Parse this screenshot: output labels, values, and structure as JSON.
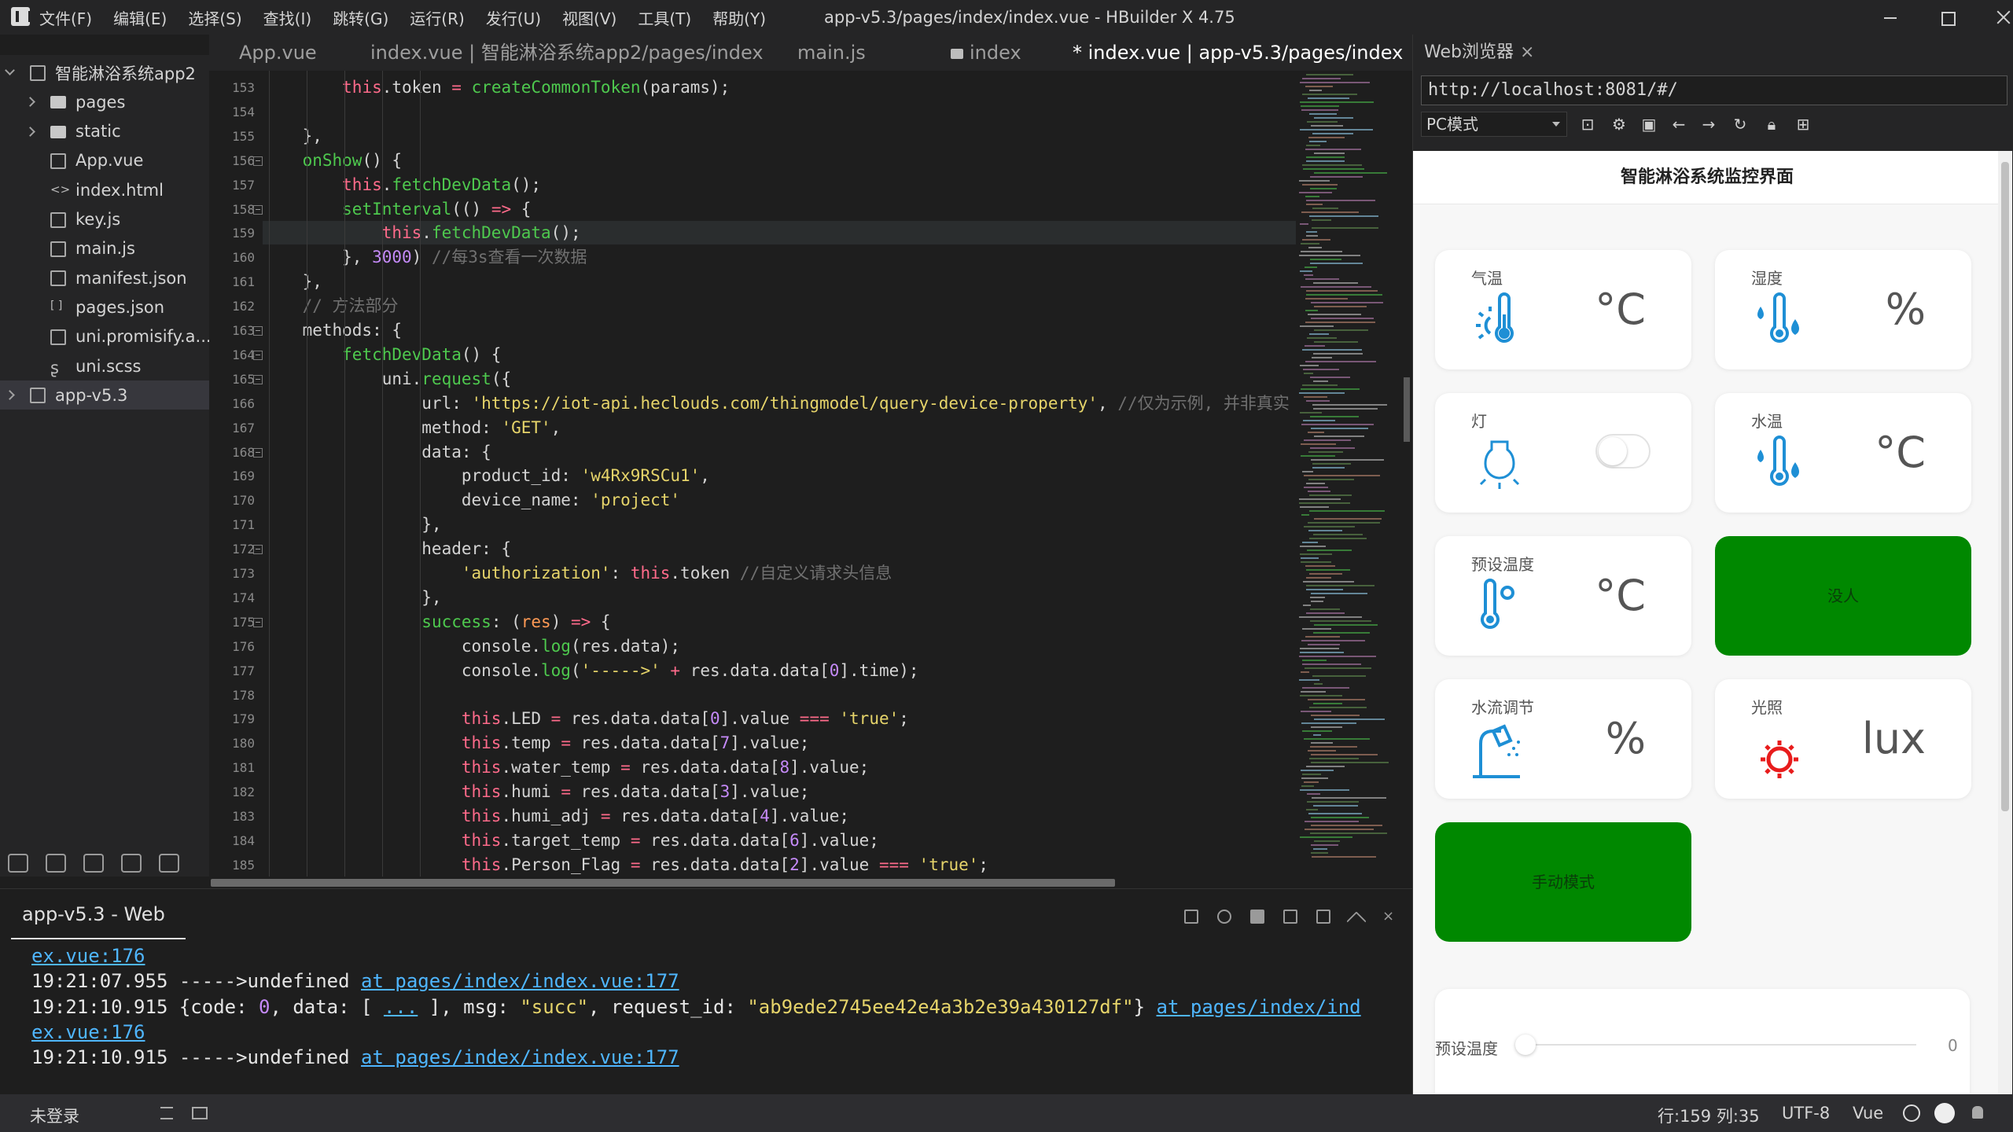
{
  "window": {
    "title": "app-v5.3/pages/index/index.vue - HBuilder X 4.75"
  },
  "menu": [
    "文件(F)",
    "编辑(E)",
    "选择(S)",
    "查找(I)",
    "跳转(G)",
    "运行(R)",
    "发行(U)",
    "视图(V)",
    "工具(T)",
    "帮助(Y)"
  ],
  "sidebar": {
    "items": [
      {
        "label": "智能淋浴系统app2",
        "kind": "project",
        "indent": 0,
        "chev": "down"
      },
      {
        "label": "pages",
        "kind": "folder",
        "indent": 1,
        "chev": "right"
      },
      {
        "label": "static",
        "kind": "folder",
        "indent": 1,
        "chev": "right"
      },
      {
        "label": "App.vue",
        "kind": "file",
        "indent": 1
      },
      {
        "label": "index.html",
        "kind": "html",
        "indent": 1
      },
      {
        "label": "key.js",
        "kind": "file",
        "indent": 1
      },
      {
        "label": "main.js",
        "kind": "file",
        "indent": 1
      },
      {
        "label": "manifest.json",
        "kind": "file",
        "indent": 1
      },
      {
        "label": "pages.json",
        "kind": "json",
        "indent": 1
      },
      {
        "label": "uni.promisify.a...",
        "kind": "file",
        "indent": 1
      },
      {
        "label": "uni.scss",
        "kind": "scss",
        "indent": 1
      },
      {
        "label": "app-v5.3",
        "kind": "project",
        "indent": 0,
        "chev": "right",
        "selected": true
      }
    ]
  },
  "tabs": [
    {
      "label": "App.vue",
      "active": false
    },
    {
      "label": "index.vue | 智能淋浴系统app2/pages/index",
      "active": false
    },
    {
      "label": "main.js",
      "active": false
    },
    {
      "label": "index",
      "active": false,
      "folder": true
    },
    {
      "label": "* index.vue | app-v5.3/pages/index",
      "active": true
    }
  ],
  "editor": {
    "lines": [
      {
        "n": "153",
        "fold": false,
        "tokens": [
          [
            "pl",
            "        "
          ],
          [
            "k",
            "this"
          ],
          [
            "pl",
            ".token "
          ],
          [
            "k",
            "="
          ],
          [
            "pl",
            " "
          ],
          [
            "f",
            "createCommonToken"
          ],
          [
            "pl",
            "(params);"
          ]
        ]
      },
      {
        "n": "154",
        "fold": false,
        "tokens": []
      },
      {
        "n": "155",
        "fold": false,
        "tokens": [
          [
            "pl",
            "    },"
          ]
        ]
      },
      {
        "n": "156",
        "fold": true,
        "tokens": [
          [
            "pl",
            "    "
          ],
          [
            "f",
            "onShow"
          ],
          [
            "pl",
            "() {"
          ]
        ]
      },
      {
        "n": "157",
        "fold": false,
        "tokens": [
          [
            "pl",
            "        "
          ],
          [
            "k",
            "this"
          ],
          [
            "pl",
            "."
          ],
          [
            "f",
            "fetchDevData"
          ],
          [
            "pl",
            "();"
          ]
        ]
      },
      {
        "n": "158",
        "fold": true,
        "tokens": [
          [
            "pl",
            "        "
          ],
          [
            "f",
            "setInterval"
          ],
          [
            "pl",
            "(() "
          ],
          [
            "k",
            "=>"
          ],
          [
            "pl",
            " {"
          ]
        ]
      },
      {
        "n": "159",
        "fold": false,
        "current": true,
        "tokens": [
          [
            "pl",
            "            "
          ],
          [
            "k",
            "this"
          ],
          [
            "pl",
            "."
          ],
          [
            "f",
            "fetchDevData"
          ],
          [
            "pl",
            "();"
          ]
        ]
      },
      {
        "n": "160",
        "fold": false,
        "tokens": [
          [
            "pl",
            "        }, "
          ],
          [
            "n",
            "3000"
          ],
          [
            "pl",
            ") "
          ],
          [
            "c",
            "//每3s查看一次数据"
          ]
        ]
      },
      {
        "n": "161",
        "fold": false,
        "tokens": [
          [
            "pl",
            "    },"
          ]
        ]
      },
      {
        "n": "162",
        "fold": false,
        "tokens": [
          [
            "pl",
            "    "
          ],
          [
            "c",
            "// 方法部分"
          ]
        ]
      },
      {
        "n": "163",
        "fold": true,
        "tokens": [
          [
            "pl",
            "    methods: {"
          ]
        ]
      },
      {
        "n": "164",
        "fold": true,
        "tokens": [
          [
            "pl",
            "        "
          ],
          [
            "f",
            "fetchDevData"
          ],
          [
            "pl",
            "() {"
          ]
        ]
      },
      {
        "n": "165",
        "fold": true,
        "tokens": [
          [
            "pl",
            "            uni."
          ],
          [
            "f",
            "request"
          ],
          [
            "pl",
            "({"
          ]
        ]
      },
      {
        "n": "166",
        "fold": false,
        "tokens": [
          [
            "pl",
            "                url: "
          ],
          [
            "s",
            "'https://iot-api.heclouds.com/thingmodel/query-device-property'"
          ],
          [
            "pl",
            ", "
          ],
          [
            "c",
            "//仅为示例, 并非真实"
          ]
        ]
      },
      {
        "n": "167",
        "fold": false,
        "tokens": [
          [
            "pl",
            "                method: "
          ],
          [
            "s",
            "'GET'"
          ],
          [
            "pl",
            ","
          ]
        ]
      },
      {
        "n": "168",
        "fold": true,
        "tokens": [
          [
            "pl",
            "                data: {"
          ]
        ]
      },
      {
        "n": "169",
        "fold": false,
        "tokens": [
          [
            "pl",
            "                    product_id: "
          ],
          [
            "s",
            "'w4Rx9RSCu1'"
          ],
          [
            "pl",
            ","
          ]
        ]
      },
      {
        "n": "170",
        "fold": false,
        "tokens": [
          [
            "pl",
            "                    device_name: "
          ],
          [
            "s",
            "'project'"
          ]
        ]
      },
      {
        "n": "171",
        "fold": false,
        "tokens": [
          [
            "pl",
            "                },"
          ]
        ]
      },
      {
        "n": "172",
        "fold": true,
        "tokens": [
          [
            "pl",
            "                header: {"
          ]
        ]
      },
      {
        "n": "173",
        "fold": false,
        "tokens": [
          [
            "pl",
            "                    "
          ],
          [
            "s",
            "'authorization'"
          ],
          [
            "pl",
            ": "
          ],
          [
            "k",
            "this"
          ],
          [
            "pl",
            ".token "
          ],
          [
            "c",
            "//自定义请求头信息"
          ]
        ]
      },
      {
        "n": "174",
        "fold": false,
        "tokens": [
          [
            "pl",
            "                },"
          ]
        ]
      },
      {
        "n": "175",
        "fold": true,
        "tokens": [
          [
            "pl",
            "                "
          ],
          [
            "f",
            "success"
          ],
          [
            "pl",
            ": ("
          ],
          [
            "p",
            "res"
          ],
          [
            "pl",
            ") "
          ],
          [
            "k",
            "=>"
          ],
          [
            "pl",
            " {"
          ]
        ]
      },
      {
        "n": "176",
        "fold": false,
        "tokens": [
          [
            "pl",
            "                    console."
          ],
          [
            "f",
            "log"
          ],
          [
            "pl",
            "(res.data);"
          ]
        ]
      },
      {
        "n": "177",
        "fold": false,
        "tokens": [
          [
            "pl",
            "                    console."
          ],
          [
            "f",
            "log"
          ],
          [
            "pl",
            "("
          ],
          [
            "s",
            "'----->'"
          ],
          [
            "pl",
            " "
          ],
          [
            "k",
            "+"
          ],
          [
            "pl",
            " res.data.data["
          ],
          [
            "n",
            "0"
          ],
          [
            "pl",
            "].time);"
          ]
        ]
      },
      {
        "n": "178",
        "fold": false,
        "tokens": []
      },
      {
        "n": "179",
        "fold": false,
        "tokens": [
          [
            "pl",
            "                    "
          ],
          [
            "k",
            "this"
          ],
          [
            "pl",
            ".LED "
          ],
          [
            "k",
            "="
          ],
          [
            "pl",
            " res.data.data["
          ],
          [
            "n",
            "0"
          ],
          [
            "pl",
            "].value "
          ],
          [
            "k",
            "==="
          ],
          [
            "pl",
            " "
          ],
          [
            "s",
            "'true'"
          ],
          [
            "pl",
            ";"
          ]
        ]
      },
      {
        "n": "180",
        "fold": false,
        "tokens": [
          [
            "pl",
            "                    "
          ],
          [
            "k",
            "this"
          ],
          [
            "pl",
            ".temp "
          ],
          [
            "k",
            "="
          ],
          [
            "pl",
            " res.data.data["
          ],
          [
            "n",
            "7"
          ],
          [
            "pl",
            "].value;"
          ]
        ]
      },
      {
        "n": "181",
        "fold": false,
        "tokens": [
          [
            "pl",
            "                    "
          ],
          [
            "k",
            "this"
          ],
          [
            "pl",
            ".water_temp "
          ],
          [
            "k",
            "="
          ],
          [
            "pl",
            " res.data.data["
          ],
          [
            "n",
            "8"
          ],
          [
            "pl",
            "].value;"
          ]
        ]
      },
      {
        "n": "182",
        "fold": false,
        "tokens": [
          [
            "pl",
            "                    "
          ],
          [
            "k",
            "this"
          ],
          [
            "pl",
            ".humi "
          ],
          [
            "k",
            "="
          ],
          [
            "pl",
            " res.data.data["
          ],
          [
            "n",
            "3"
          ],
          [
            "pl",
            "].value;"
          ]
        ]
      },
      {
        "n": "183",
        "fold": false,
        "tokens": [
          [
            "pl",
            "                    "
          ],
          [
            "k",
            "this"
          ],
          [
            "pl",
            ".humi_adj "
          ],
          [
            "k",
            "="
          ],
          [
            "pl",
            " res.data.data["
          ],
          [
            "n",
            "4"
          ],
          [
            "pl",
            "].value;"
          ]
        ]
      },
      {
        "n": "184",
        "fold": false,
        "tokens": [
          [
            "pl",
            "                    "
          ],
          [
            "k",
            "this"
          ],
          [
            "pl",
            ".target_temp "
          ],
          [
            "k",
            "="
          ],
          [
            "pl",
            " res.data.data["
          ],
          [
            "n",
            "6"
          ],
          [
            "pl",
            "].value;"
          ]
        ]
      },
      {
        "n": "185",
        "fold": false,
        "tokens": [
          [
            "pl",
            "                    "
          ],
          [
            "k",
            "this"
          ],
          [
            "pl",
            ".Person_Flag "
          ],
          [
            "k",
            "="
          ],
          [
            "pl",
            " res.data.data["
          ],
          [
            "n",
            "2"
          ],
          [
            "pl",
            "].value "
          ],
          [
            "k",
            "==="
          ],
          [
            "pl",
            " "
          ],
          [
            "s",
            "'true'"
          ],
          [
            "pl",
            ";"
          ]
        ]
      }
    ]
  },
  "console": {
    "title": "app-v5.3 - Web",
    "lines": [
      [
        [
          "lnk",
          "ex.vue:176"
        ]
      ],
      [
        [
          "t",
          "19:21:07.955 ----->undefined "
        ],
        [
          "lnk",
          "at pages/index/index.vue:177"
        ]
      ],
      [
        [
          "t",
          "19:21:10.915 {code: "
        ],
        [
          "cn",
          "0"
        ],
        [
          "t",
          ", data: [ "
        ],
        [
          "lnk",
          "..."
        ],
        [
          "t",
          " ], msg: "
        ],
        [
          "cs",
          "\"succ\""
        ],
        [
          "t",
          ", request_id: "
        ],
        [
          "cs",
          "\"ab9ede2745ee42e4a3b2e39a430127df\""
        ],
        [
          "t",
          "} "
        ],
        [
          "lnk",
          "at pages/index/ind"
        ]
      ],
      [
        [
          "lnk",
          "ex.vue:176"
        ]
      ],
      [
        [
          "t",
          "19:21:10.915 ----->undefined "
        ],
        [
          "lnk",
          "at pages/index/index.vue:177"
        ]
      ]
    ]
  },
  "status": {
    "login": "未登录",
    "position": "行:159  列:35",
    "encoding": "UTF-8",
    "language": "Vue"
  },
  "browser": {
    "tab_label": "Web浏览器",
    "tab_close": "×",
    "url": "http://localhost:8081/#/",
    "mode": "PC模式",
    "app": {
      "title": "智能淋浴系统监控界面",
      "cards": [
        {
          "title": "气温",
          "unit": "°C",
          "icon": "thermometer-sun-icon"
        },
        {
          "title": "湿度",
          "unit": "%",
          "icon": "humidity-drops-icon"
        },
        {
          "title": "灯",
          "unit": "",
          "icon": "lightbulb-icon",
          "toggle": true
        },
        {
          "title": "水温",
          "unit": "°C",
          "icon": "water-temp-icon"
        },
        {
          "title": "预设温度",
          "unit": "°C",
          "icon": "thermometer-gear-icon"
        },
        {
          "green": "没人"
        },
        {
          "title": "水流调节",
          "unit": "%",
          "icon": "shower-icon"
        },
        {
          "title": "光照",
          "unit": "lux",
          "icon": "sun-icon"
        },
        {
          "green": "手动模式"
        }
      ],
      "slider": {
        "label": "预设温度",
        "value": "0"
      }
    }
  }
}
